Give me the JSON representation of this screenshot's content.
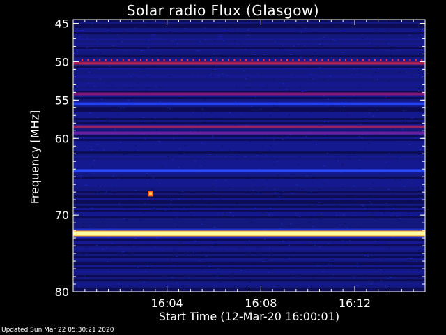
{
  "chart_data": {
    "type": "heatmap",
    "title": "Solar radio Flux (Glasgow)",
    "xlabel": "Start Time (12-Mar-20 16:00:01)",
    "ylabel": "Frequency [MHz]",
    "xlim_minutes": [
      0,
      15
    ],
    "ylim_mhz": [
      44.5,
      80
    ],
    "y_inverted": true,
    "x_ticks": [
      {
        "label": "16:04",
        "minute": 4
      },
      {
        "label": "16:08",
        "minute": 8
      },
      {
        "label": "16:12",
        "minute": 12
      }
    ],
    "y_ticks": [
      45,
      50,
      55,
      60,
      70,
      80
    ],
    "colormap": [
      "#000010",
      "#10106a",
      "#1a20c8",
      "#3050ff",
      "#8020a0",
      "#c03060",
      "#ff8000",
      "#ffff80",
      "#ffffff"
    ],
    "background_color": "#10106a",
    "bands": [
      {
        "freq_mhz": 50.2,
        "intensity": "medium-high",
        "color": "#b02050",
        "dotted": true
      },
      {
        "freq_mhz": 54.2,
        "intensity": "medium",
        "color": "#8a1878"
      },
      {
        "freq_mhz": 55.5,
        "intensity": "low-medium",
        "color": "#2040f0"
      },
      {
        "freq_mhz": 58.5,
        "intensity": "medium",
        "color": "#9a2060"
      },
      {
        "freq_mhz": 59.3,
        "intensity": "low-medium",
        "color": "#7020a0"
      },
      {
        "freq_mhz": 64.2,
        "intensity": "low-medium",
        "color": "#2a4cff"
      },
      {
        "freq_mhz": 72.4,
        "intensity": "very-high",
        "color": "#ffffa0"
      }
    ],
    "spots": [
      {
        "minute": 3.3,
        "freq_mhz": 67.2,
        "intensity": "high",
        "color": "#ffd060"
      }
    ]
  },
  "footer": "Updated Sun Mar 22 05:30:21 2020"
}
